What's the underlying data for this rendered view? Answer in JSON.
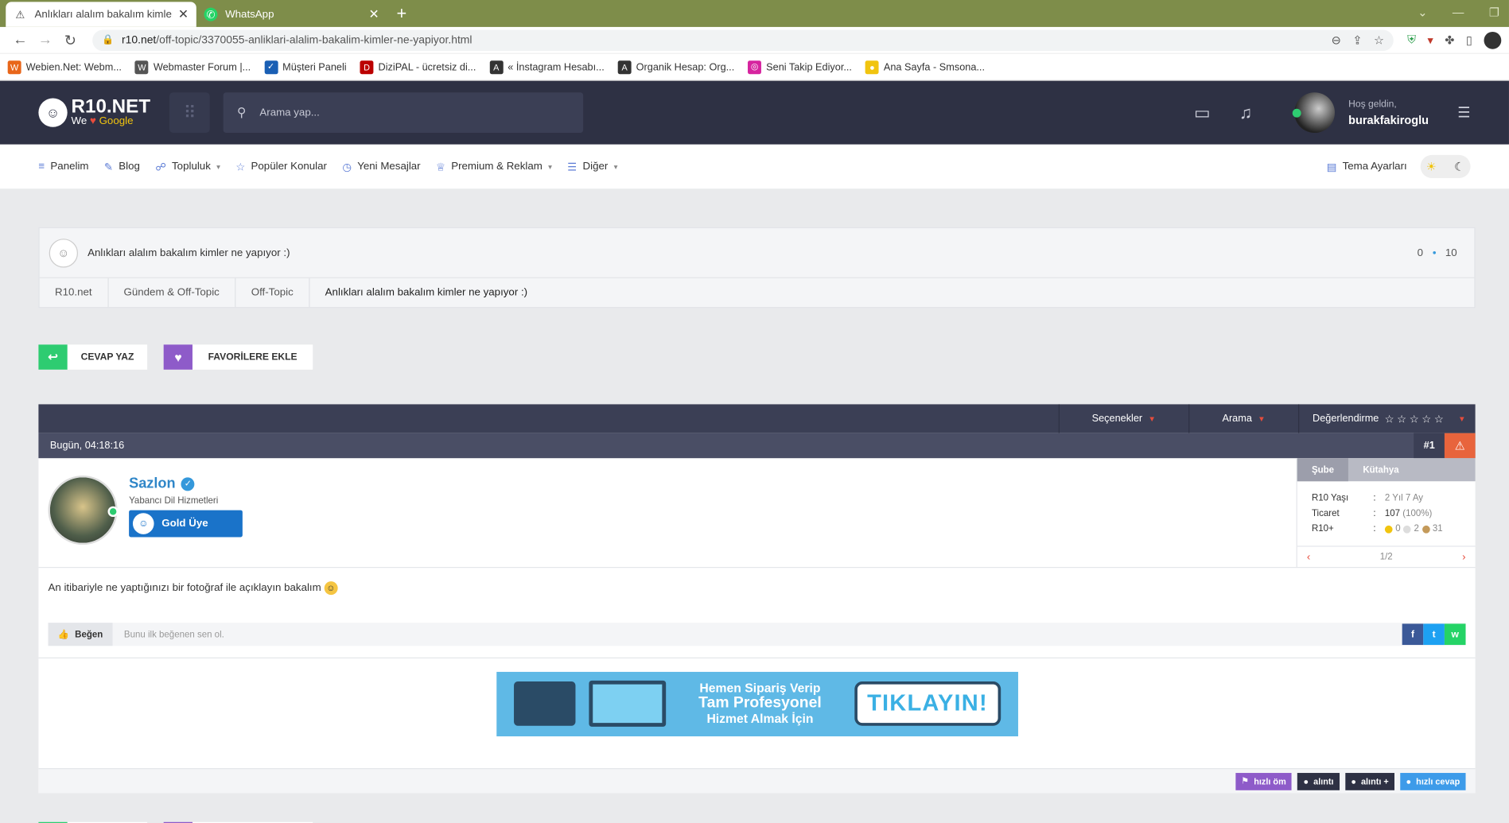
{
  "browser": {
    "tabs": [
      {
        "title": "Anlıkları alalım bakalım kimler ne"
      },
      {
        "title": "WhatsApp"
      }
    ],
    "url_domain": "r10.net",
    "url_path": "/off-topic/3370055-anliklari-alalim-bakalim-kimler-ne-yapiyor.html",
    "bookmarks": [
      {
        "label": "Webien.Net: Webm...",
        "color": "#e8661a",
        "glyph": "W"
      },
      {
        "label": "Webmaster Forum |...",
        "color": "#555",
        "glyph": "W"
      },
      {
        "label": "Müşteri Paneli",
        "color": "#1a5fb4",
        "glyph": "✓"
      },
      {
        "label": "DiziPAL - ücretsiz di...",
        "color": "#b00",
        "glyph": "D"
      },
      {
        "label": "« İnstagram Hesabı...",
        "color": "#333",
        "glyph": "A"
      },
      {
        "label": "Organik Hesap: Org...",
        "color": "#333",
        "glyph": "A"
      },
      {
        "label": "Seni Takip Ediyor...",
        "color": "#d6249f",
        "glyph": "◎"
      },
      {
        "label": "Ana Sayfa - Smsona...",
        "color": "#f1c40f",
        "glyph": "●"
      }
    ]
  },
  "header": {
    "logo_name": "R10.NET",
    "logo_tag_we": "We",
    "logo_tag_heart": "♥",
    "logo_tag_google": "Google",
    "search_placeholder": "Arama yap...",
    "greeting": "Hoş geldin,",
    "username": "burakfakiroglu"
  },
  "nav": {
    "items": [
      {
        "label": "Panelim",
        "icon": "sliders-icon"
      },
      {
        "label": "Blog",
        "icon": "feather-icon"
      },
      {
        "label": "Topluluk",
        "icon": "users-icon"
      },
      {
        "label": "Popüler Konular",
        "icon": "star-icon"
      },
      {
        "label": "Yeni Mesajlar",
        "icon": "clock-icon"
      },
      {
        "label": "Premium & Reklam",
        "icon": "trophy-icon"
      },
      {
        "label": "Diğer",
        "icon": "list-icon"
      }
    ],
    "theme_label": "Tema Ayarları"
  },
  "thread": {
    "title": "Anlıkları alalım bakalım kimler ne yapıyor :)",
    "stat_left": "0",
    "stat_right": "10",
    "breadcrumbs": [
      "R10.net",
      "Gündem & Off-Topic",
      "Off-Topic",
      "Anlıkları alalım bakalım kimler ne yapıyor :)"
    ]
  },
  "actions": {
    "reply": "CEVAP YAZ",
    "favorite": "FAVORİLERE EKLE"
  },
  "post": {
    "toolbar": {
      "options": "Seçenekler",
      "search": "Arama",
      "rating": "Değerlendirme",
      "stars": "☆☆☆☆☆"
    },
    "date": "Bugün, 04:18:16",
    "number": "#1",
    "author": {
      "name": "Sazlon",
      "title": "Yabancı Dil Hizmetleri",
      "rank": "Gold Üye"
    },
    "info": {
      "tab_active": "Şube",
      "tab_other": "Kütahya",
      "age_label": "R10 Yaşı",
      "age_value": "2 Yıl 7 Ay",
      "trade_label": "Ticaret",
      "trade_value": "107",
      "trade_pct": "(100%)",
      "r10_label": "R10+",
      "r10_gold": "0",
      "r10_silver": "2",
      "r10_bronze": "31",
      "page": "1/2"
    },
    "message": "An itibariyle ne yaptığınızı bir fotoğraf ile açıklayın bakalım",
    "like_label": "Beğen",
    "like_hint": "Bunu ilk beğenen sen ol.",
    "banner": {
      "line1": "Hemen Sipariş Verip",
      "line2": "Tam Profesyonel",
      "line3": "Hizmet Almak İçin",
      "cta": "TIKLAYIN!"
    },
    "quick": {
      "pm": "hızlı öm",
      "quote": "alıntı",
      "quote_plus": "alıntı +",
      "reply": "hızlı cevap"
    }
  }
}
